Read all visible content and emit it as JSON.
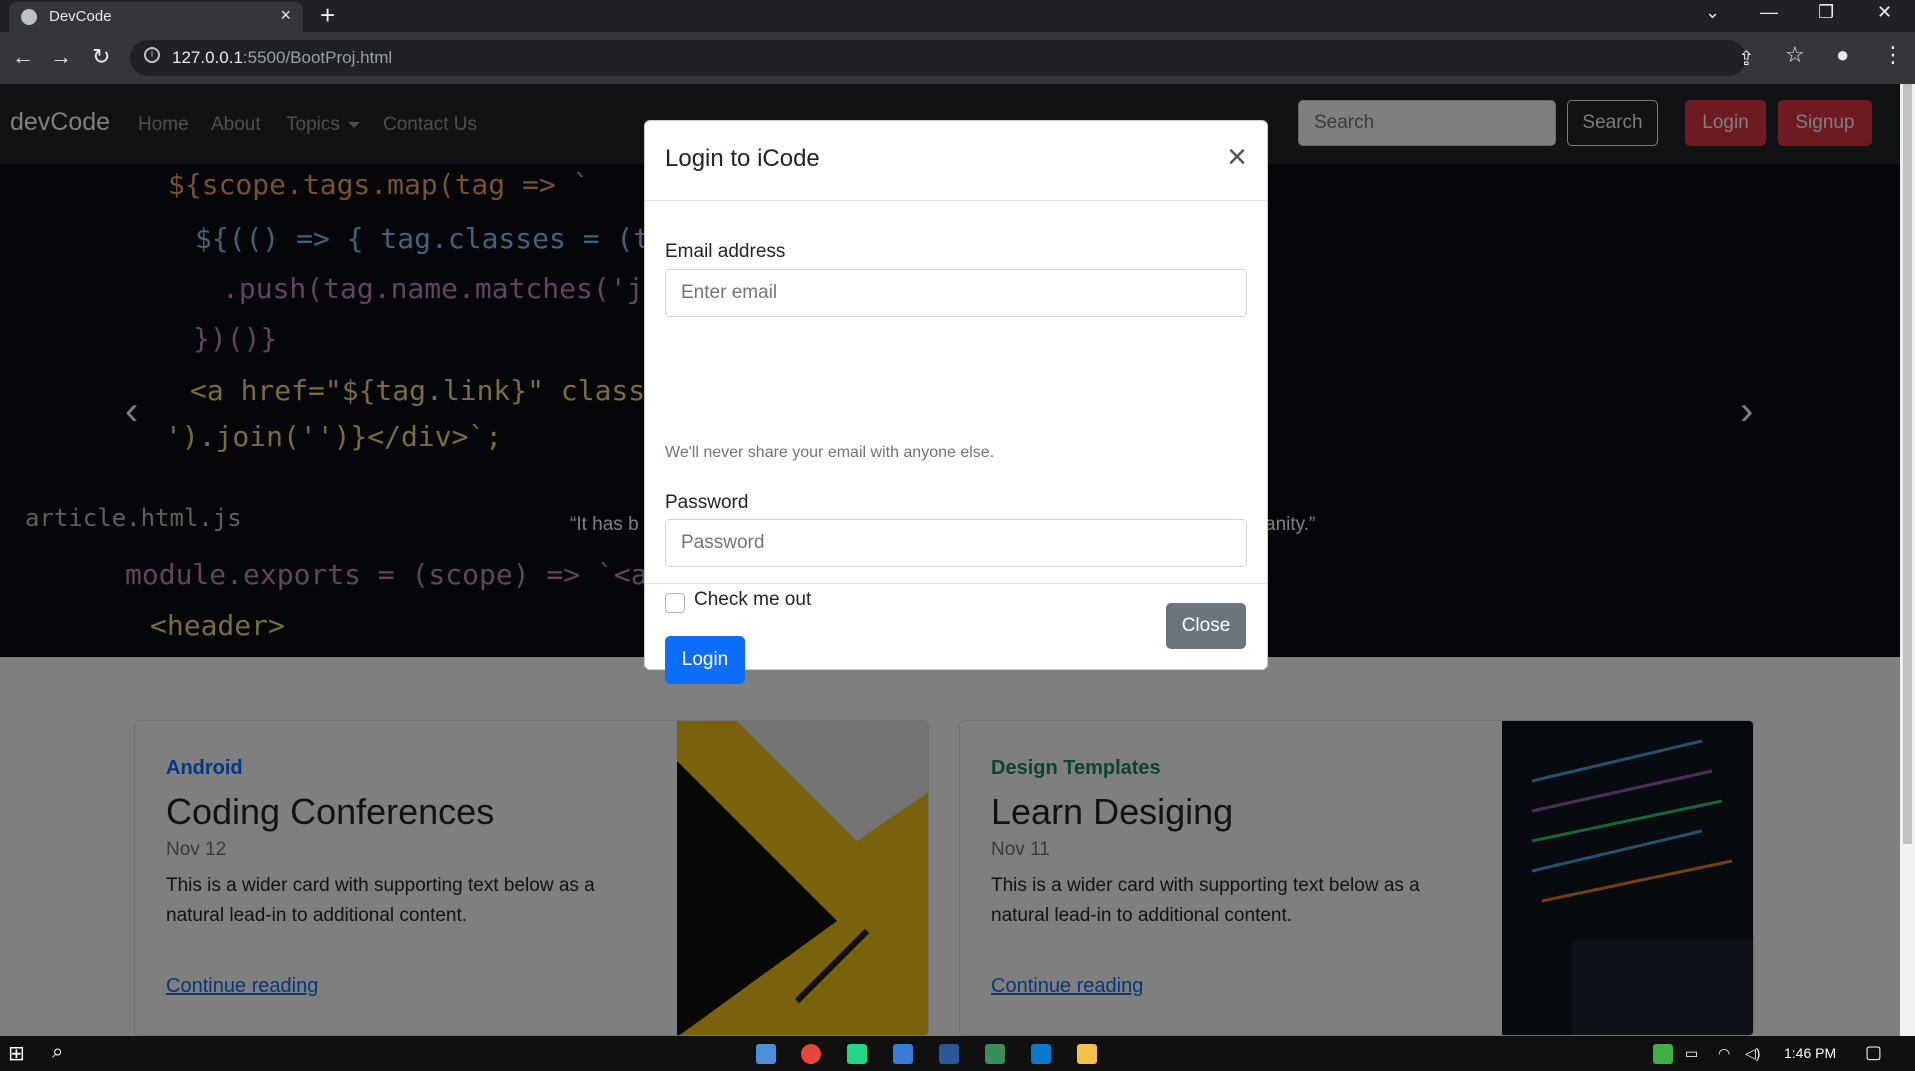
{
  "browser": {
    "tab_title": "DevCode",
    "tab_close": "×",
    "new_tab": "+",
    "url_host": "127.0.0.1",
    "url_path": ":5500/BootProj.html",
    "window_controls": [
      "⌄",
      "—",
      "❐",
      "✕"
    ]
  },
  "navbar": {
    "brand": "devCode",
    "links": [
      "Home",
      "About",
      "Topics",
      "Contact Us"
    ],
    "search_placeholder": "Search",
    "search_button": "Search",
    "login_button": "Login",
    "signup_button": "Signup"
  },
  "carousel": {
    "caption_left": "“It has b",
    "caption_right": "anity.”",
    "prev": "‹",
    "next": "›",
    "code": [
      "${scope.tags.map(tag => `",
      "${(() => { tag.classes = (tag.c",
      ".push(tag.name.matches('js')",
      "})()}",
      "<a href=\"${tag.link}\" class=\"${t",
      "').join('')}</div>`;",
      "article.html.js",
      "module.exports = (scope) => `<article",
      "<header>"
    ]
  },
  "cards": [
    {
      "category": "Android",
      "title": "Coding Conferences",
      "date": "Nov 12",
      "text": "This is a wider card with supporting text below as a natural lead-in to additional content.",
      "link": "Continue reading"
    },
    {
      "category": "Design Templates",
      "title": "Learn Desiging",
      "date": "Nov 11",
      "text": "This is a wider card with supporting text below as a natural lead-in to additional content.",
      "link": "Continue reading"
    }
  ],
  "modal": {
    "title": "Login to iCode",
    "close_x": "×",
    "email_label": "Email address",
    "email_placeholder": "Enter email",
    "email_help": "We'll never share your email with anyone else.",
    "password_label": "Password",
    "password_placeholder": "Password",
    "checkbox_label": "Check me out",
    "submit": "Login",
    "close_button": "Close"
  },
  "taskbar": {
    "time": "1:46 PM"
  },
  "colors": {
    "primary": "#0d6efd",
    "danger": "#dc3545",
    "secondary": "#6c757d",
    "android": "#0d6efd",
    "design": "#198754"
  }
}
